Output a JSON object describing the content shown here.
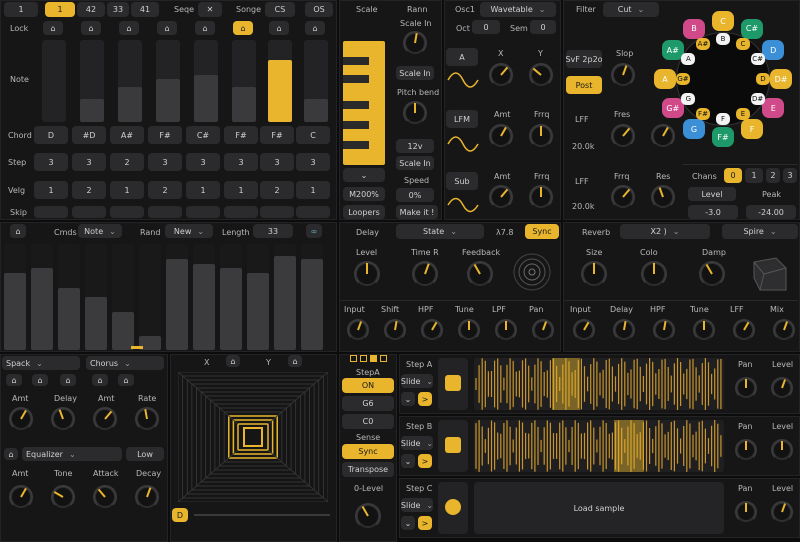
{
  "seq": {
    "tabs": [
      "1",
      "1",
      "42",
      "33",
      "41"
    ],
    "seq_label": "Seqe",
    "close": "✕",
    "song_label": "Songe",
    "cs": "CS",
    "os": "OS",
    "rows": [
      "Lock",
      "Note",
      "Chord",
      "Step",
      "Velg",
      "Skip"
    ],
    "note_levels": [
      0,
      0.3,
      0.45,
      0.55,
      0.6,
      0.45,
      0.8,
      0.3
    ],
    "chords": [
      "D",
      "#D",
      "A#",
      "F#",
      "C#",
      "F#",
      "F#",
      "C"
    ],
    "steps": [
      "3",
      "3",
      "2",
      "3",
      "3",
      "3",
      "3",
      "3"
    ],
    "velg": [
      "1",
      "2",
      "1",
      "2",
      "1",
      "1",
      "2",
      "1"
    ]
  },
  "cmds": {
    "label": "Cmds",
    "note": "Note",
    "rand": "Rand",
    "new": "New",
    "length": "Length",
    "length_val": "33",
    "bars": [
      0.8,
      0.85,
      0.65,
      0.55,
      0.4,
      0.15,
      0.95,
      0.9,
      0.85,
      0.8,
      0.98,
      0.95
    ]
  },
  "scale": {
    "title": "Scale",
    "root": "Rann",
    "scale_in": "Scale In",
    "scale_in2": "Scale In",
    "pitch_bend": "Pitch bend",
    "pb_val": "12v",
    "scale_in3": "Scale In",
    "speed": "Speed",
    "speed_val": "0%",
    "mod": "M200%",
    "loopers": "Loopers",
    "make": "Make it !"
  },
  "osc": {
    "title": "Osc1",
    "wave": "Wavetable",
    "oct": "Oct",
    "oct_val": "0",
    "sem": "Sem",
    "sem_val": "0",
    "a": "A",
    "x": "X",
    "y": "Y",
    "lfm": "LFM",
    "amt": "Amt",
    "frq": "Frrq",
    "sub": "Sub",
    "amt2": "Amt",
    "frq2": "Frrq"
  },
  "filter": {
    "title": "Filter",
    "type": "Cut",
    "svf": "SvF 2p2o",
    "slop": "Slop",
    "post": "Post",
    "lff": "LFF",
    "fres": "Fres",
    "lff_val": "20.0k",
    "lff2": "LFF",
    "frrq": "Frrq",
    "res": "Res",
    "lff2_val": "20.0k",
    "chans": "Chans",
    "chan_vals": [
      "0",
      "1",
      "2",
      "3"
    ],
    "level": "Level",
    "peak": "Peak",
    "level_val": "-3.0",
    "peak_val": "-24.00"
  },
  "wheel": {
    "notes": [
      "C",
      "C#",
      "D",
      "D#",
      "E",
      "F",
      "F#",
      "G",
      "G#",
      "A",
      "A#",
      "B"
    ],
    "inner": [
      "B",
      "C",
      "C#",
      "D",
      "D#",
      "E",
      "F",
      "F#",
      "G",
      "G#",
      "A",
      "A#"
    ]
  },
  "delay": {
    "title": "Delay",
    "state": "State",
    "sync_time": "λ7.8",
    "sync": "Sync",
    "level": "Level",
    "time": "Time R",
    "feedback": "Feedback",
    "row": [
      "Input",
      "Shift",
      "HPF",
      "Tune",
      "LPF",
      "Pan"
    ]
  },
  "reverb": {
    "title": "Reverb",
    "x2": "X2 )",
    "spire": "Spire",
    "size": "Size",
    "color": "Colo ",
    "damp": "Damp",
    "row": [
      "Input",
      "Delay",
      "HPF",
      "Tune",
      "LFF",
      "Mix"
    ]
  },
  "fx": {
    "spack": "Spack",
    "chorus": "Chorus",
    "amt": "Amt",
    "delay": "Delay",
    "amt2": "Amt",
    "rate": "Rate",
    "eq": "Equalizer",
    "low": "Low",
    "amt3": "Amt",
    "tone": "Tone",
    "attack": "Attack",
    "decay": "Decay"
  },
  "xy": {
    "x": "X",
    "y": "Y",
    "d": "D"
  },
  "step": {
    "title": "StepA",
    "on": "ON",
    "g": "G6",
    "c": "C0",
    "sense": "Sense",
    "sync": "Sync",
    "transpose": "Transpose",
    "level": "0-Level"
  },
  "tracks": [
    {
      "name": "Step A",
      "mode": "Slide"
    },
    {
      "name": "Step B",
      "mode": "Slide"
    },
    {
      "name": "Step C",
      "mode": "Slide",
      "load": "Load sample"
    }
  ],
  "track_knobs": {
    "pan": "Pan",
    "level": "Level"
  }
}
